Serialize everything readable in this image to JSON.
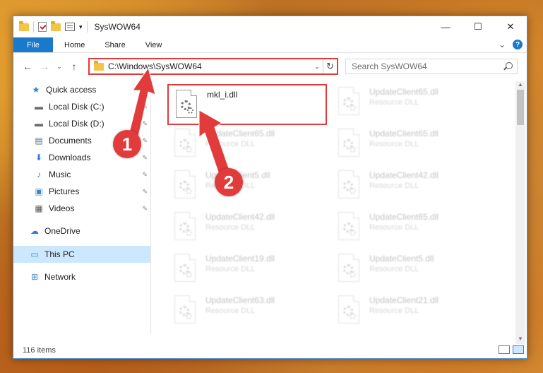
{
  "window": {
    "title": "SysWOW64",
    "controls": {
      "minimize": "—",
      "maximize": "☐",
      "close": "✕"
    }
  },
  "ribbon": {
    "tabs": [
      "File",
      "Home",
      "Share",
      "View"
    ],
    "expand_glyph": "⌄",
    "help_glyph": "?"
  },
  "nav": {
    "back": "←",
    "forward": "→",
    "recent": "⌄",
    "up": "↑",
    "address": "C:\\Windows\\SysWOW64",
    "address_drop": "⌄",
    "refresh": "↻",
    "search_placeholder": "Search SysWOW64"
  },
  "sidebar": {
    "items": [
      {
        "label": "Quick access",
        "icon": "star-icon",
        "glyph": "★",
        "color": "#2f7fd8",
        "pinned": false
      },
      {
        "label": "Local Disk (C:)",
        "icon": "drive-icon",
        "glyph": "▬",
        "color": "#6b6b6b",
        "pinned": true
      },
      {
        "label": "Local Disk (D:)",
        "icon": "drive-icon",
        "glyph": "▬",
        "color": "#6b6b6b",
        "pinned": true
      },
      {
        "label": "Documents",
        "icon": "documents-icon",
        "glyph": "▤",
        "color": "#5a6f8c",
        "pinned": true
      },
      {
        "label": "Downloads",
        "icon": "download-icon",
        "glyph": "⬇",
        "color": "#2f7fd8",
        "pinned": true
      },
      {
        "label": "Music",
        "icon": "music-icon",
        "glyph": "♪",
        "color": "#2f7fd8",
        "pinned": true
      },
      {
        "label": "Pictures",
        "icon": "pictures-icon",
        "glyph": "▣",
        "color": "#3b87c8",
        "pinned": true
      },
      {
        "label": "Videos",
        "icon": "videos-icon",
        "glyph": "▦",
        "color": "#555555",
        "pinned": true
      },
      {
        "label": "OneDrive",
        "icon": "cloud-icon",
        "glyph": "☁",
        "color": "#2f7fd8",
        "pinned": false
      },
      {
        "label": "This PC",
        "icon": "computer-icon",
        "glyph": "▭",
        "color": "#3b87c8",
        "pinned": false,
        "selected": true
      },
      {
        "label": "Network",
        "icon": "network-icon",
        "glyph": "⊞",
        "color": "#3b87c8",
        "pinned": false
      }
    ],
    "pin_glyph": "📌"
  },
  "files": [
    {
      "name": "mkl_i.dll",
      "type": "",
      "highlighted": true
    },
    {
      "name": "UpdateClient65.dll",
      "type": "Resource DLL"
    },
    {
      "name": "UpdateClient65.dll",
      "type": "Resource DLL"
    },
    {
      "name": "UpdateClient65.dll",
      "type": "Resource DLL"
    },
    {
      "name": "UpdateClient5.dll",
      "type": "Resource DLL"
    },
    {
      "name": "UpdateClient42.dll",
      "type": "Resource DLL"
    },
    {
      "name": "UpdateClient42.dll",
      "type": "Resource DLL"
    },
    {
      "name": "UpdateClient65.dll",
      "type": "Resource DLL"
    },
    {
      "name": "UpdateClient19.dll",
      "type": "Resource DLL"
    },
    {
      "name": "UpdateClient5.dll",
      "type": "Resource DLL"
    },
    {
      "name": "UpdateClient63.dll",
      "type": "Resource DLL"
    },
    {
      "name": "UpdateClient21.dll",
      "type": "Resource DLL"
    }
  ],
  "status": {
    "item_count": "116 items"
  },
  "annotations": {
    "badge1": "1",
    "badge2": "2",
    "color": "#e23b3b"
  }
}
